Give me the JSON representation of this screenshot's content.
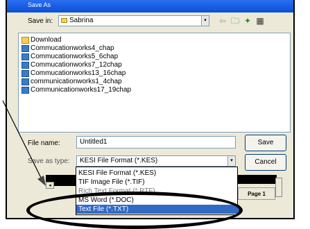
{
  "window": {
    "title": "Save As"
  },
  "save_in": {
    "label": "Save in:",
    "value": "Sabrina"
  },
  "toolbar": {
    "back_icon": "back-arrow-icon",
    "up_icon": "up-folder-icon",
    "new_folder_icon": "new-folder-icon",
    "views_icon": "views-icon"
  },
  "files": [
    {
      "name": "Download",
      "icon": "folder-icon"
    },
    {
      "name": "Commucationworks4_chap",
      "icon": "document-icon"
    },
    {
      "name": "Commucationworks5_6chap",
      "icon": "document-icon"
    },
    {
      "name": "Commucationworks7_12chap",
      "icon": "document-icon"
    },
    {
      "name": "Commucationworks13_16chap",
      "icon": "document-icon"
    },
    {
      "name": "communicationworks1_4chap",
      "icon": "document-icon"
    },
    {
      "name": "Communicationworks17_19chap",
      "icon": "document-icon"
    }
  ],
  "file_name": {
    "label": "File name:",
    "value": "Untitled1"
  },
  "save_as_type": {
    "label": "Save as type:",
    "value": "KESI File Format (*.KES)",
    "options": [
      "KESI File Format (*.KES)",
      "TIF Image File (*.TIF)",
      "Rich Text Format (*.RTF)",
      "MS Word (*.DOC)",
      "Text File (*.TXT)"
    ],
    "selected_index": 4
  },
  "buttons": {
    "save": "Save",
    "cancel": "Cancel"
  },
  "background": {
    "page_label": "Page 1"
  },
  "accent_colors": {
    "titlebar": "#0a4fd6",
    "selection": "#316ac5",
    "annotation": "#000000"
  }
}
